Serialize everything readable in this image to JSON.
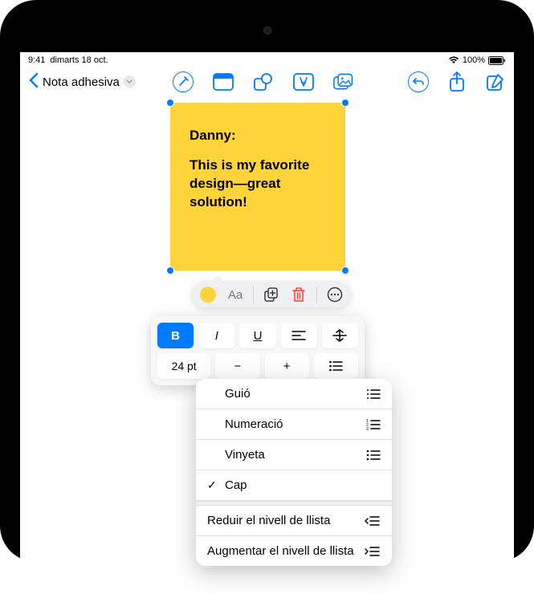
{
  "status": {
    "time": "9:41",
    "date": "dimarts 18 oct.",
    "battery": "100%"
  },
  "nav": {
    "title": "Nota adhesiva"
  },
  "note": {
    "line1": "Danny:",
    "line2": "This is my favorite design—great solution!"
  },
  "context": {
    "text_label": "Aa"
  },
  "format": {
    "bold": "B",
    "italic": "I",
    "underline": "U",
    "font_size": "24 pt",
    "minus": "−",
    "plus": "+"
  },
  "menu": {
    "items": [
      {
        "label": "Guió",
        "checked": false,
        "icon": "dash-list"
      },
      {
        "label": "Numeració",
        "checked": false,
        "icon": "number-list"
      },
      {
        "label": "Vinyeta",
        "checked": false,
        "icon": "bullet-list"
      },
      {
        "label": "Cap",
        "checked": true,
        "icon": ""
      }
    ],
    "indent_out": "Reduir el nivell de llista",
    "indent_in": "Augmentar el nivell de llista"
  }
}
